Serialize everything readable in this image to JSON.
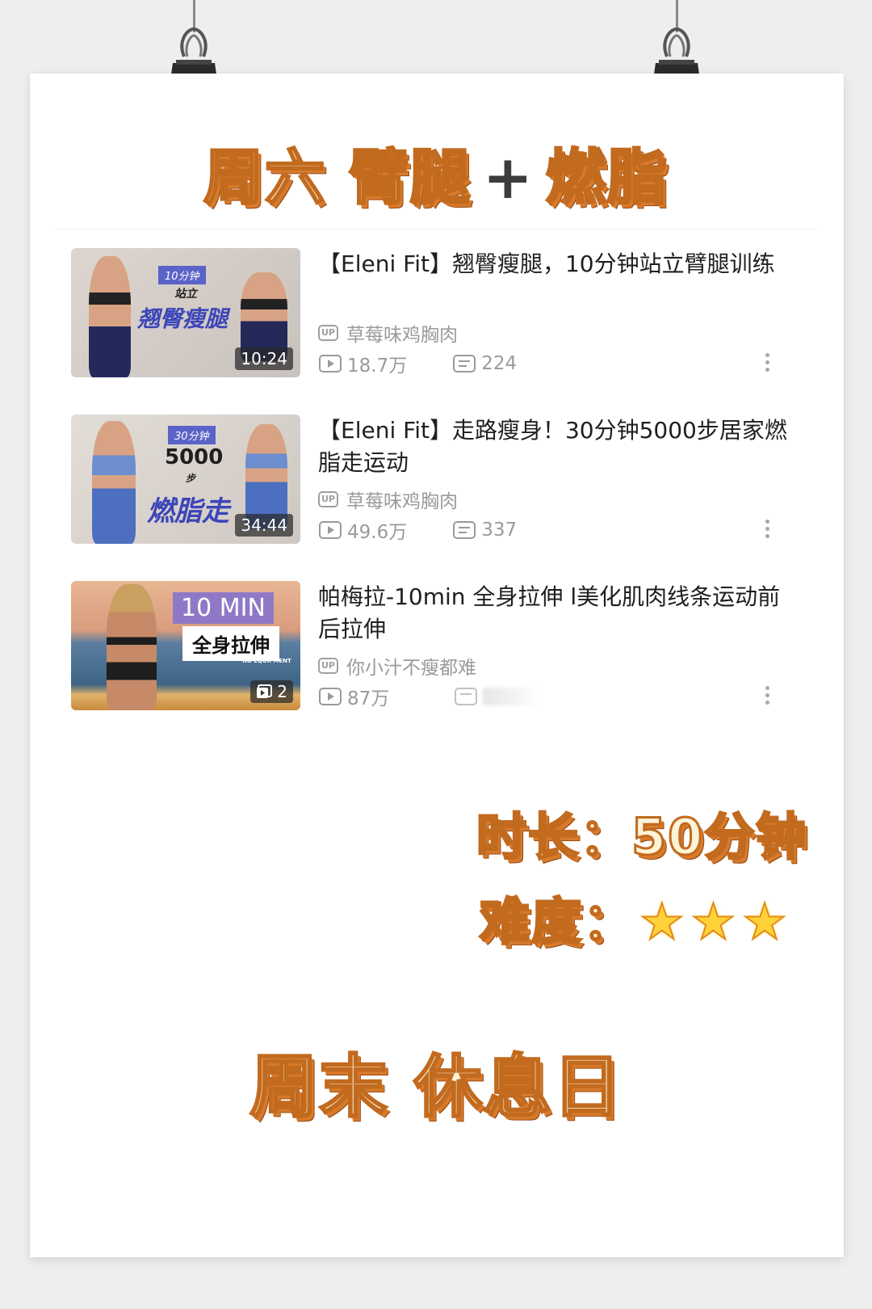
{
  "header": {
    "title_left": "周六 臂腿",
    "title_plus": "+",
    "title_right": "燃脂"
  },
  "videos": [
    {
      "title": "【Eleni  Fit】翘臀瘦腿，10分钟站立臂腿训练",
      "uploader": "草莓味鸡胸肉",
      "views": "18.7万",
      "comments": "224",
      "duration": "10:24",
      "thumb_tag": "10分钟",
      "thumb_line1": "站立",
      "thumb_line2": "翘臀瘦腿",
      "thumb_color": "#5a63c8"
    },
    {
      "title": "【Eleni  Fit】走路瘦身！30分钟5000步居家燃脂走运动",
      "uploader": "草莓味鸡胸肉",
      "views": "49.6万",
      "comments": "337",
      "duration": "34:44",
      "thumb_tag": "30分钟",
      "thumb_line1": "5000",
      "thumb_line1b": "步",
      "thumb_line2": "燃脂走",
      "thumb_color": "#5a63c8"
    },
    {
      "title": "帕梅拉-10min  全身拉伸  l美化肌肉线条运动前后拉伸",
      "uploader": "你小汁不瘦都难",
      "views": "87万",
      "comments": "",
      "duration": "2",
      "thumb_tag": "10 MIN",
      "thumb_line1": "全身拉伸",
      "thumb_line2": "NO EQUIPMENT",
      "thumb_color": "#8f79c7"
    }
  ],
  "icons": {
    "up_badge": "UP",
    "play": "play-icon",
    "comment": "danmaku-icon",
    "more": "more-vertical-icon"
  },
  "summary": {
    "duration_label": "时长：",
    "duration_value": "50分钟",
    "difficulty_label": "难度：",
    "difficulty_stars": 3
  },
  "footer": {
    "rest_text": "周末 休息日"
  },
  "colors": {
    "heading_fill": "#fdf3d6",
    "heading_stroke": "#c26a1e",
    "star": "#ffd23a"
  }
}
